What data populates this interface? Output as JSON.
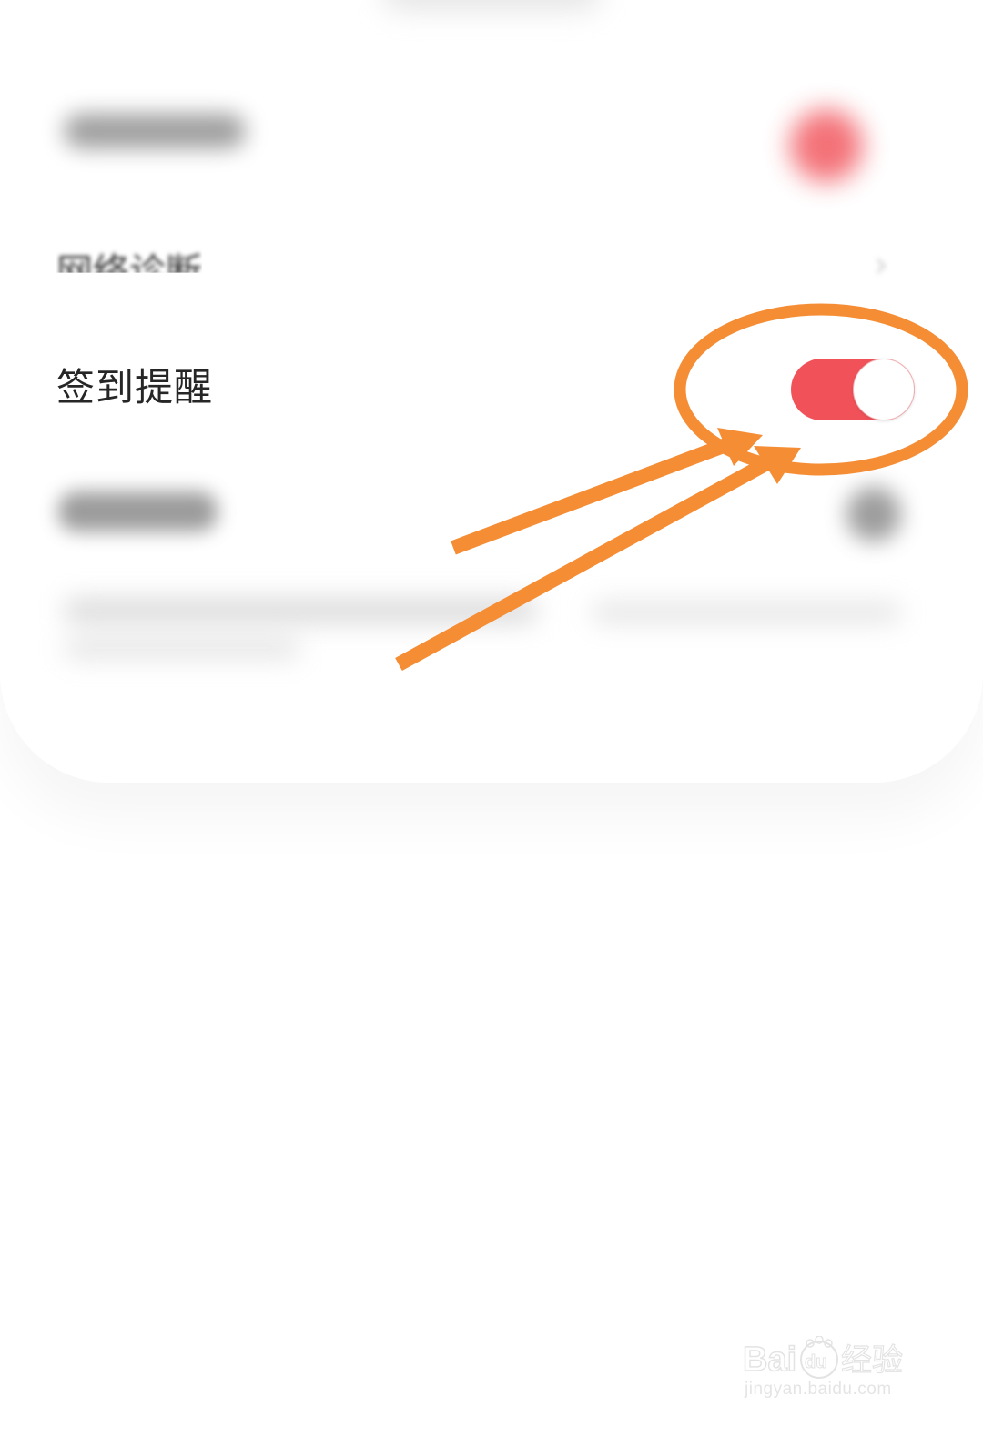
{
  "settings": {
    "items": [
      {
        "label": "",
        "has_badge": true
      },
      {
        "label": "网络诊断",
        "has_chevron": true
      },
      {
        "label": "签到提醒",
        "toggle_on": true
      },
      {
        "label": "",
        "has_icon": true
      },
      {
        "label": ""
      }
    ]
  },
  "colors": {
    "toggle_on": "#f1525a",
    "annotation": "#f58d35",
    "badge": "#f2636a"
  },
  "icons": {
    "chevron": "chevron-right-icon"
  },
  "watermark": {
    "logo_text": "Baidu经验",
    "url": "jingyan.baidu.com"
  }
}
